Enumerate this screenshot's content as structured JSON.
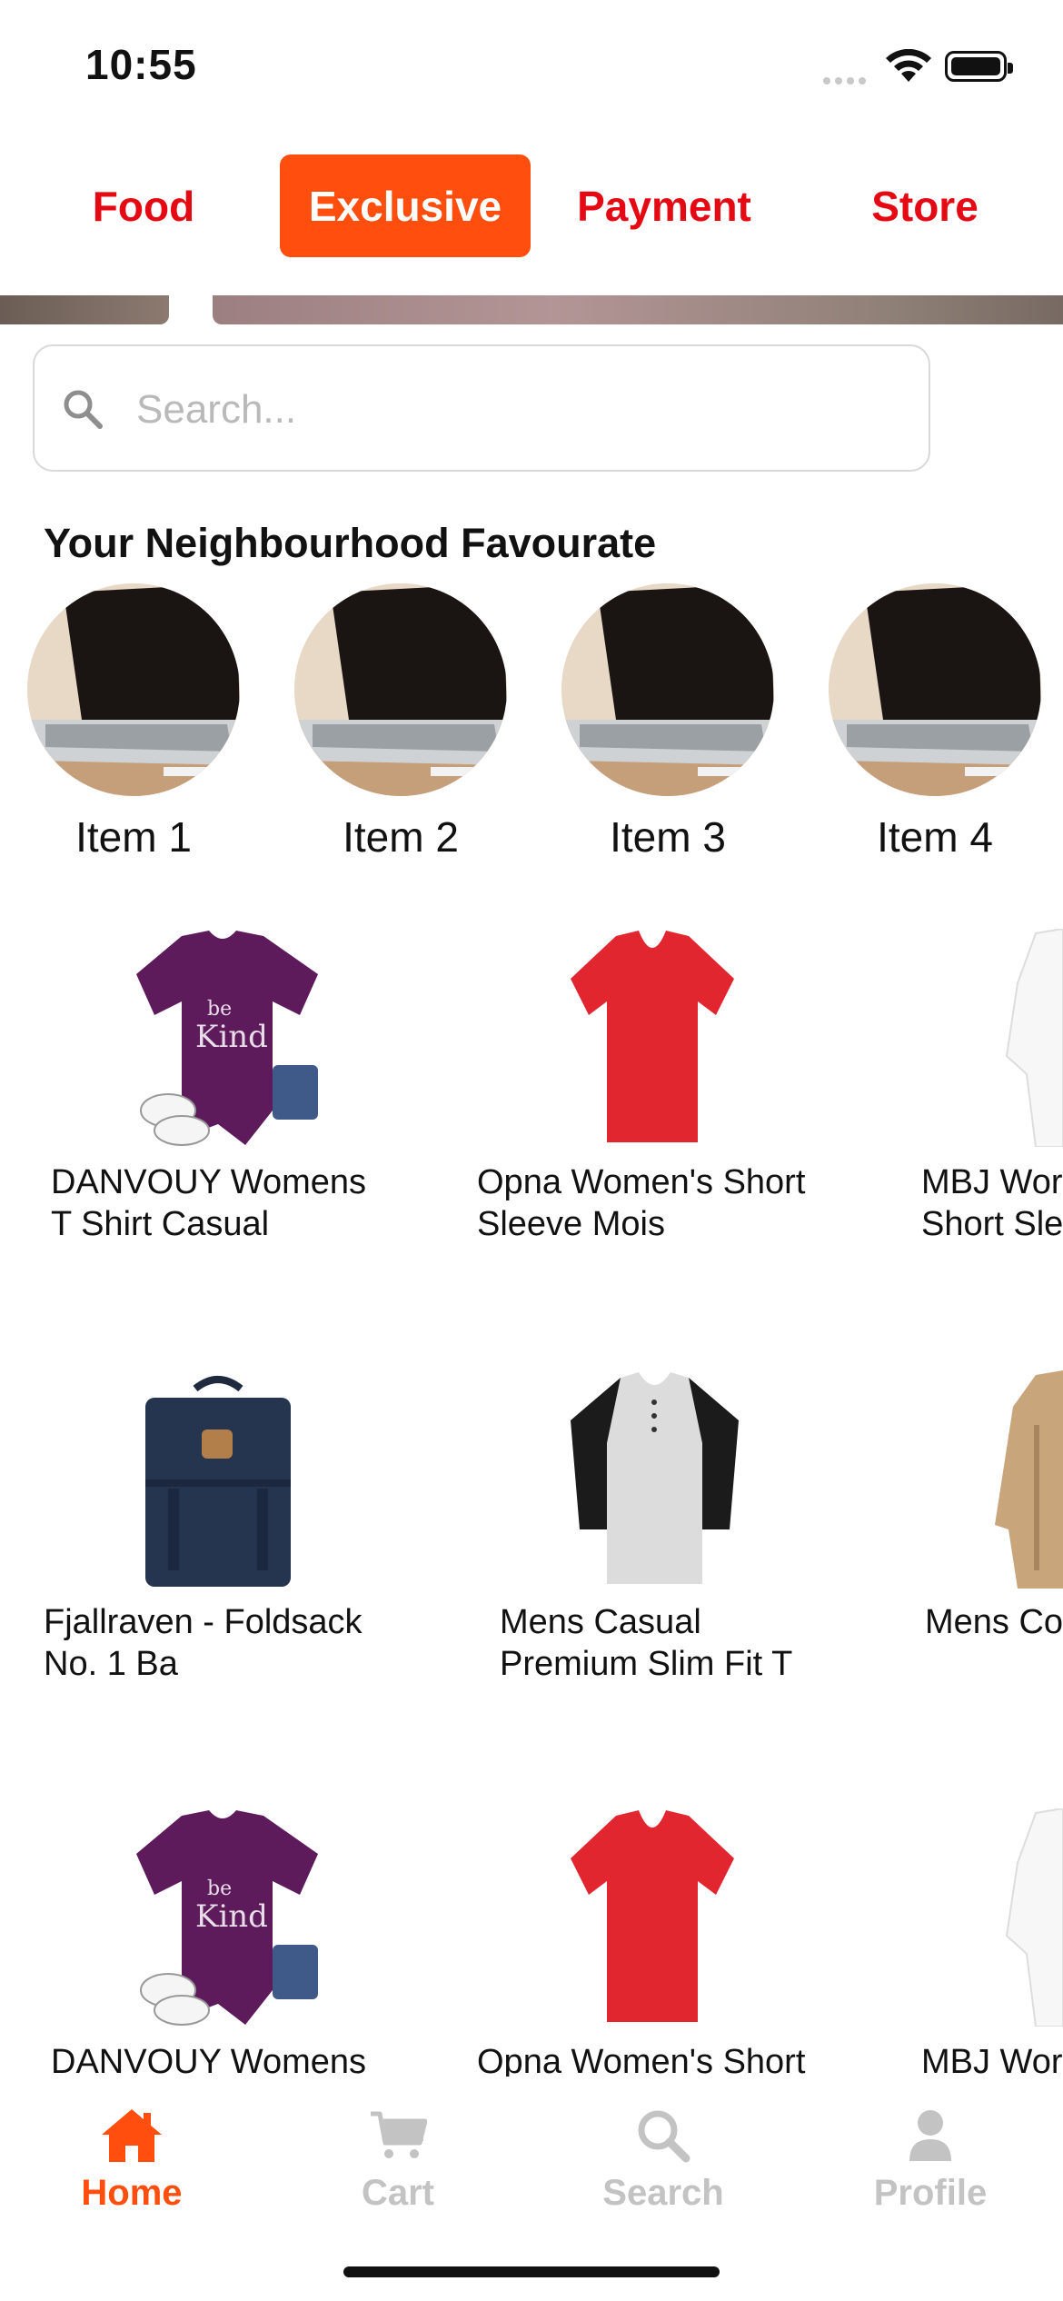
{
  "status_bar": {
    "time": "10:55"
  },
  "top_tabs": [
    {
      "label": "Food",
      "active": false
    },
    {
      "label": "Exclusive",
      "active": true
    },
    {
      "label": "Payment",
      "active": false
    },
    {
      "label": "Store",
      "active": false
    }
  ],
  "search": {
    "placeholder": "Search...",
    "value": ""
  },
  "favourites": {
    "title": "Your Neighbourhood Favourate",
    "items": [
      {
        "label": "Item 1"
      },
      {
        "label": "Item 2"
      },
      {
        "label": "Item 3"
      },
      {
        "label": "Item 4"
      }
    ]
  },
  "products": [
    {
      "name": "DANVOUY Womens\nT Shirt Casual",
      "image": "purple-be-kind-tshirt"
    },
    {
      "name": "Opna Women's Short\nSleeve Mois",
      "image": "red-vneck-tshirt"
    },
    {
      "name": "MBJ Wor\nShort Sle",
      "image": "white-tshirt"
    },
    {
      "name": "Fjallraven - Foldsack\nNo. 1 Ba",
      "image": "navy-backpack"
    },
    {
      "name": "Mens Casual\nPremium Slim Fit T",
      "image": "raglan-henley-shirt"
    },
    {
      "name": "Mens Co",
      "image": "beige-jacket"
    },
    {
      "name": "DANVOUY Womens",
      "image": "purple-be-kind-tshirt"
    },
    {
      "name": "Opna Women's Short",
      "image": "red-vneck-tshirt"
    },
    {
      "name": "MBJ Wor",
      "image": "white-tshirt"
    }
  ],
  "tab_bar": [
    {
      "label": "Home",
      "icon": "home-icon",
      "active": true
    },
    {
      "label": "Cart",
      "icon": "cart-icon",
      "active": false
    },
    {
      "label": "Search",
      "icon": "search-icon",
      "active": false
    },
    {
      "label": "Profile",
      "icon": "profile-icon",
      "active": false
    }
  ],
  "colors": {
    "accent": "#ff4e0d",
    "tab_text": "#e50914",
    "inactive": "#c3c3c3"
  }
}
